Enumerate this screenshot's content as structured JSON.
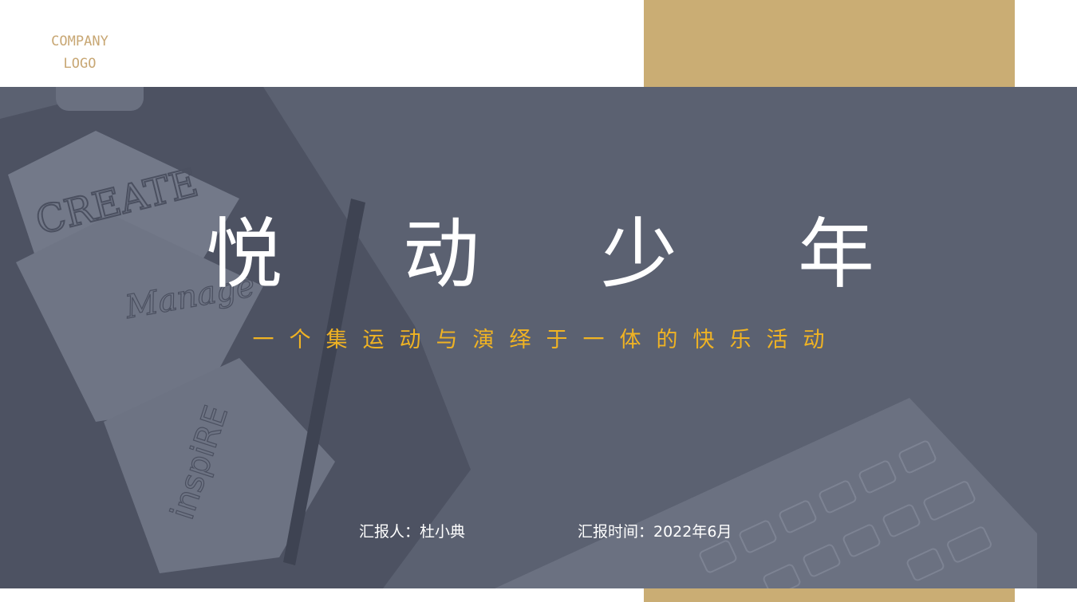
{
  "logo": {
    "line1": "COMPANY",
    "line2": "LOGO"
  },
  "title": {
    "chars": [
      "悦",
      "动",
      "少",
      "年"
    ]
  },
  "subtitle": "一个集运动与演绎于一体的快乐活动",
  "reporter": "汇报人：杜小典",
  "report_time": "汇报时间：2022年6月",
  "background_words": [
    "CREATE",
    "Manage",
    "inspiRE"
  ],
  "colors": {
    "gold": "#caad74",
    "overlay": "#5b6171",
    "title": "#ffffff",
    "subtitle": "#f0b323"
  }
}
